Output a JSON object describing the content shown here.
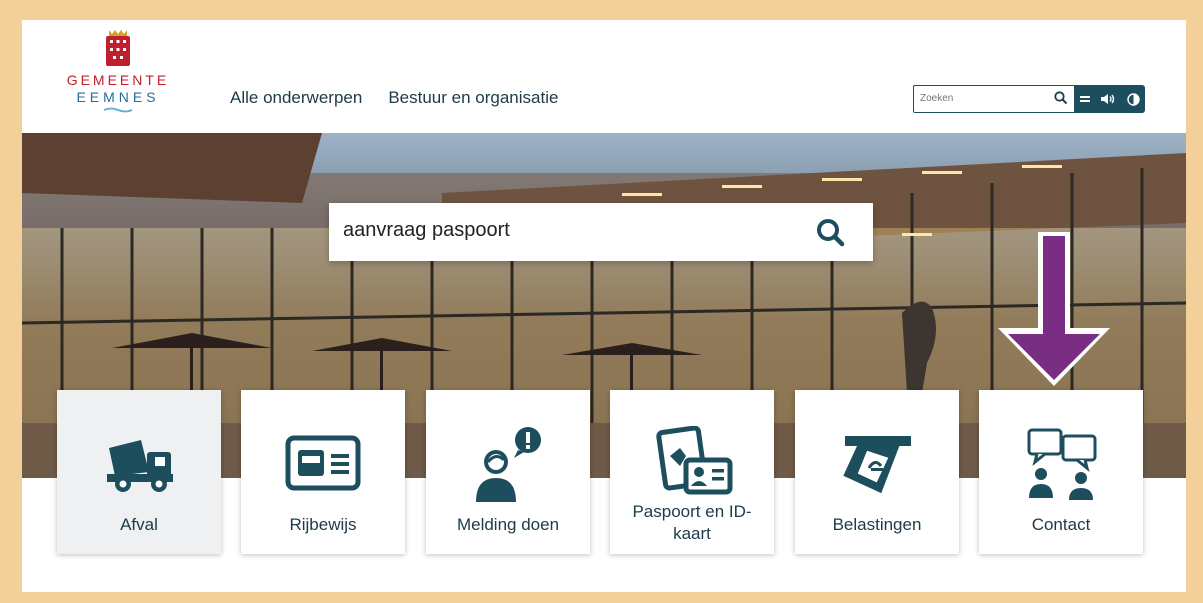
{
  "logo": {
    "line1": "GEMEENTE",
    "line2": "EEMNES"
  },
  "nav": {
    "items": [
      "Alle onderwerpen",
      "Bestuur en organisatie"
    ]
  },
  "header_search": {
    "placeholder": "Zoeken"
  },
  "main_search": {
    "value": "aanvraag paspoort"
  },
  "tiles": [
    {
      "label": "Afval",
      "icon": "garbage-truck-icon"
    },
    {
      "label": "Rijbewijs",
      "icon": "drivers-license-icon"
    },
    {
      "label": "Melding doen",
      "icon": "person-alert-icon"
    },
    {
      "label": "Paspoort en ID-kaart",
      "icon": "passport-id-icon"
    },
    {
      "label": "Belastingen",
      "icon": "tax-card-icon"
    },
    {
      "label": "Contact",
      "icon": "chat-people-icon"
    }
  ],
  "colors": {
    "accent": "#1d4e5e",
    "brand_red": "#c01f2e",
    "arrow": "#7a2e83",
    "frame": "#f3cf9a"
  }
}
